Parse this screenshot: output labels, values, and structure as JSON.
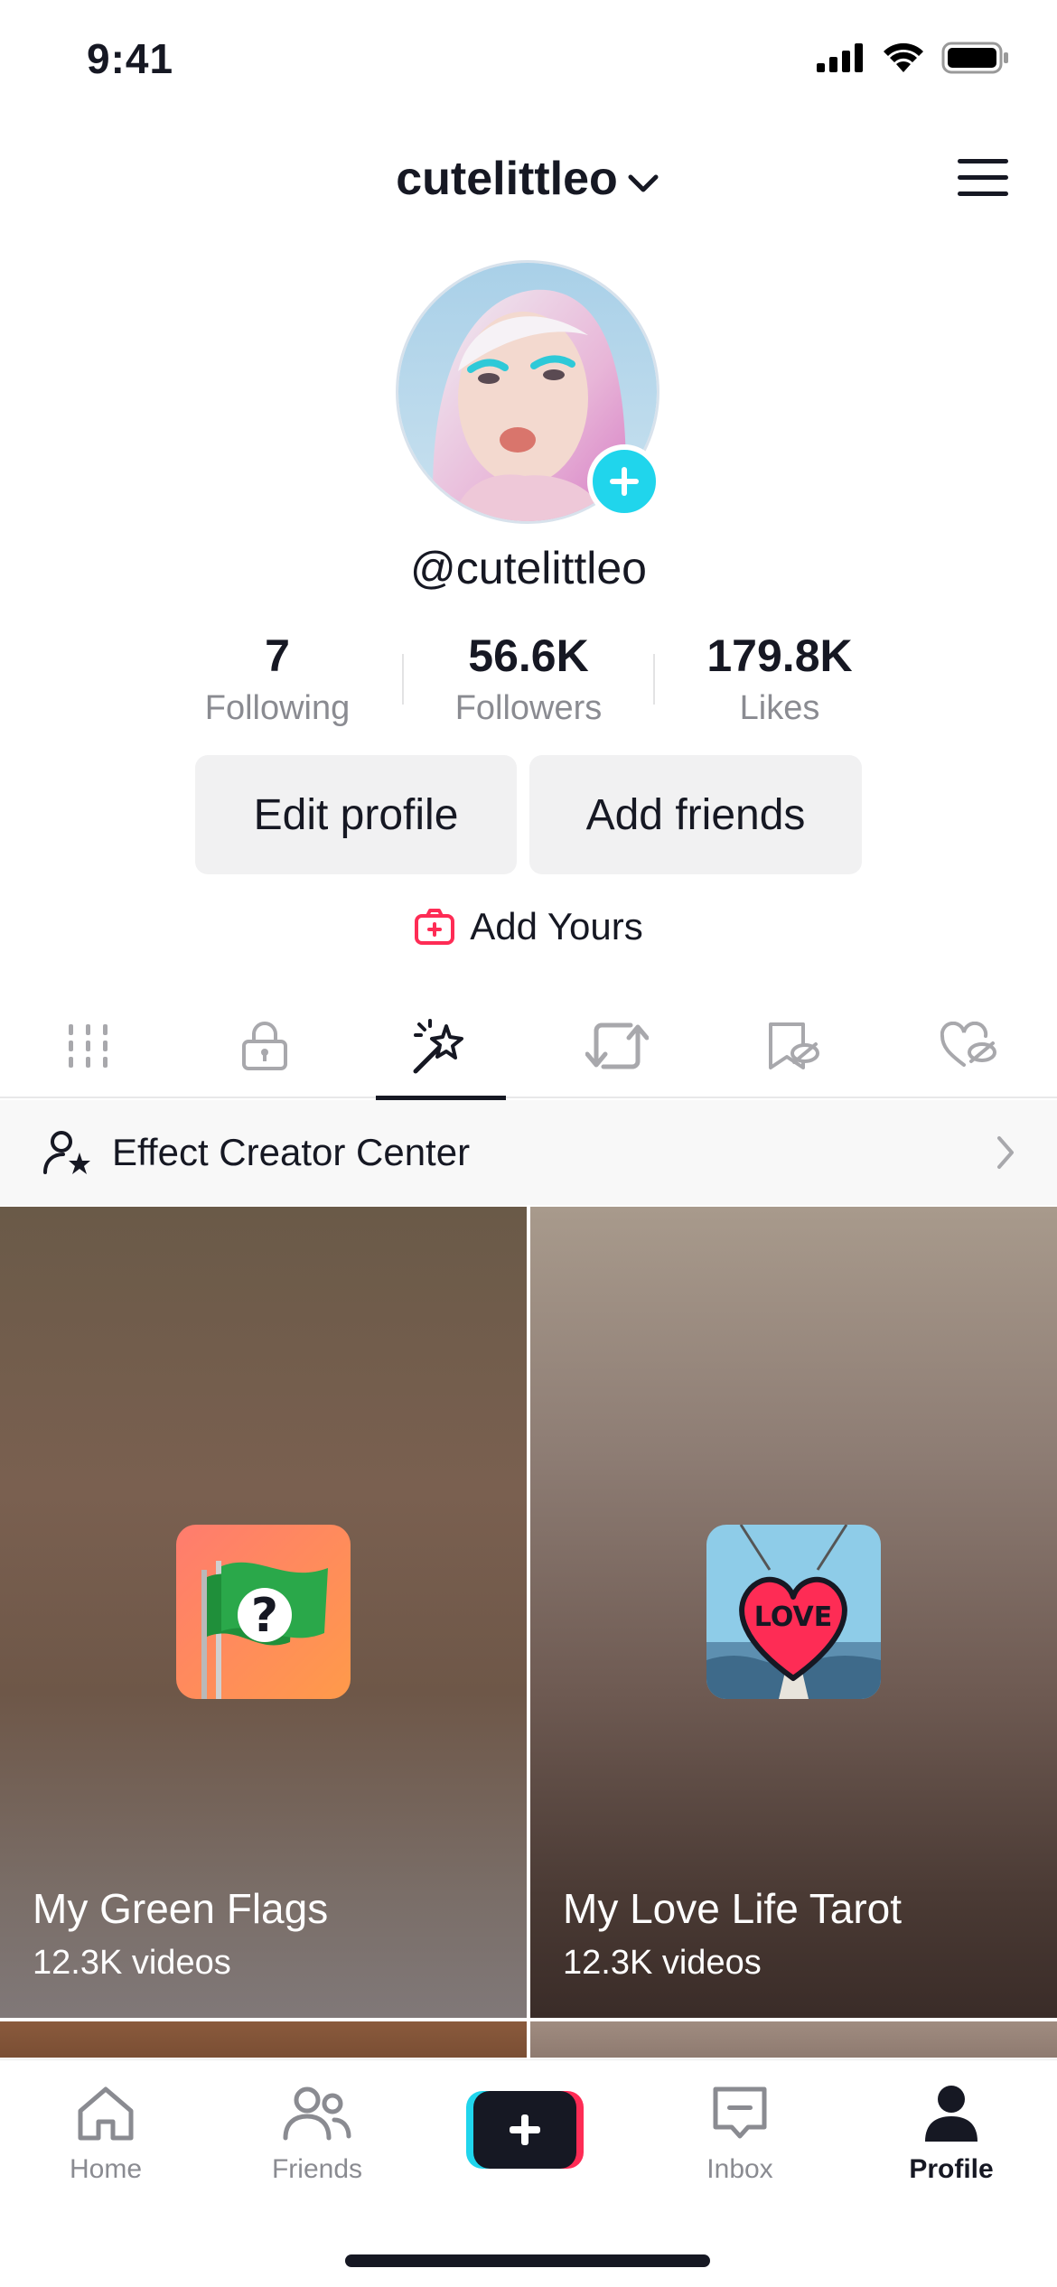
{
  "status_bar": {
    "time": "9:41"
  },
  "header": {
    "username": "cutelittleo"
  },
  "profile": {
    "handle": "@cutelittleo",
    "stats": [
      {
        "value": "7",
        "label": "Following"
      },
      {
        "value": "56.6K",
        "label": "Followers"
      },
      {
        "value": "179.8K",
        "label": "Likes"
      }
    ],
    "edit_profile_label": "Edit profile",
    "add_friends_label": "Add friends",
    "add_yours_label": "Add Yours"
  },
  "tabs": [
    {
      "icon": "grid-icon",
      "active": false
    },
    {
      "icon": "lock-icon",
      "active": false
    },
    {
      "icon": "effects-wand-icon",
      "active": true
    },
    {
      "icon": "repost-icon",
      "active": false
    },
    {
      "icon": "bookmark-hidden-icon",
      "active": false
    },
    {
      "icon": "liked-hidden-icon",
      "active": false
    }
  ],
  "effect_creator": {
    "label": "Effect Creator Center"
  },
  "effects": [
    {
      "title": "My Green Flags",
      "count": "12.3K videos"
    },
    {
      "title": "My Love Life Tarot",
      "count": "12.3K videos",
      "thumb_text": "LOVE"
    }
  ],
  "bottom_nav": [
    {
      "label": "Home",
      "icon": "home-icon",
      "active": false
    },
    {
      "label": "Friends",
      "icon": "friends-icon",
      "active": false
    },
    {
      "label": "",
      "icon": "create-plus-icon",
      "active": false
    },
    {
      "label": "Inbox",
      "icon": "inbox-icon",
      "active": false
    },
    {
      "label": "Profile",
      "icon": "profile-icon",
      "active": true
    }
  ],
  "colors": {
    "accent_cyan": "#20d5ec",
    "accent_red": "#fe2c55",
    "text_primary": "#161823",
    "text_secondary": "#8a8b91"
  }
}
